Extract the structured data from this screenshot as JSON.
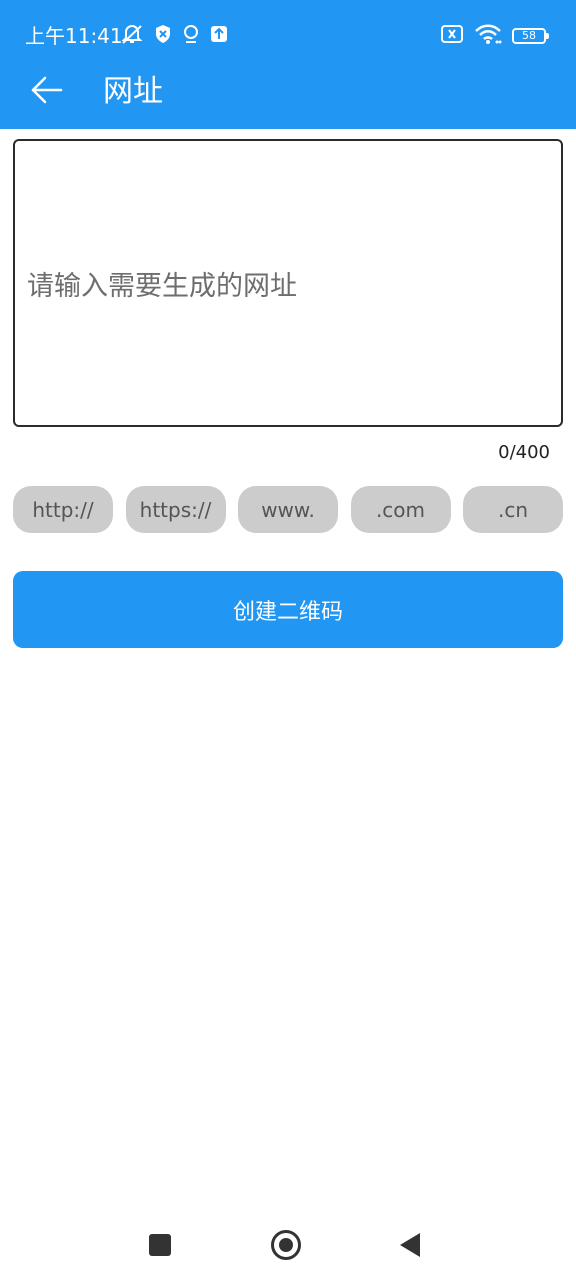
{
  "status_bar": {
    "time": "上午11:41",
    "battery_level": "58",
    "icons": [
      "muted-alarm-icon",
      "shield-icon",
      "location-icon",
      "upload-icon",
      "sim-x-icon",
      "wifi-icon",
      "battery-icon"
    ]
  },
  "app_bar": {
    "back_icon": "arrow-left-icon",
    "title": "网址"
  },
  "url_input": {
    "value": "",
    "placeholder": "请输入需要生成的网址",
    "counter": "0/400"
  },
  "chips": [
    "http://",
    "https://",
    "www.",
    ".com",
    ".cn"
  ],
  "create_button": {
    "label": "创建二维码"
  },
  "colors": {
    "primary": "#2196F3",
    "chip_bg": "#cccccc",
    "chip_text": "#555555"
  },
  "nav_bar": {
    "icons": [
      "recents-square-icon",
      "home-circle-icon",
      "back-triangle-icon"
    ]
  }
}
